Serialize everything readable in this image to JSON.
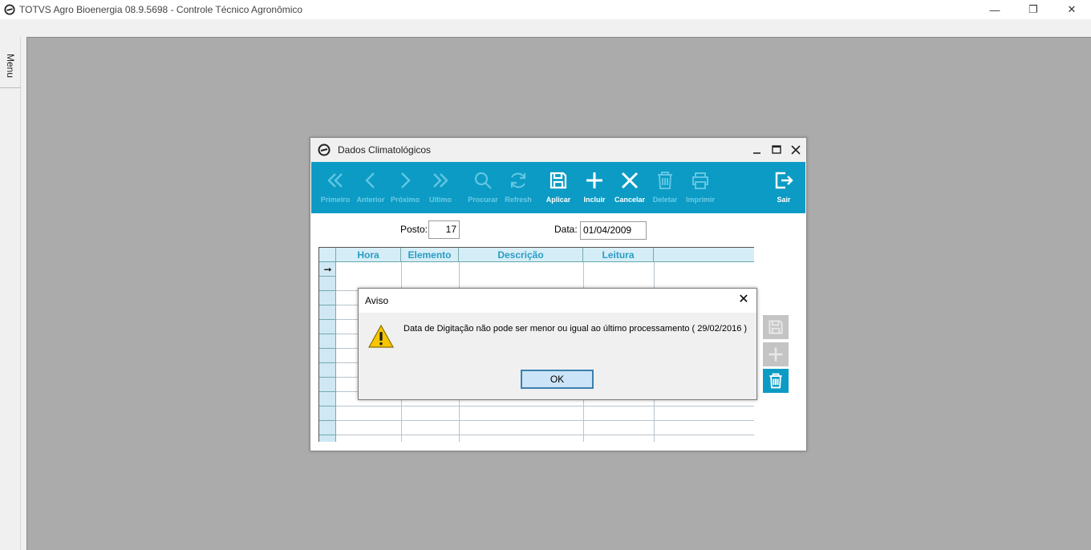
{
  "app": {
    "title": "TOTVS Agro Bioenergia 08.9.5698 - Controle Técnico Agronômico",
    "window_controls": {
      "minimize": "—",
      "restore": "❐",
      "close": "✕"
    }
  },
  "sidebar": {
    "menu_label": "Menu"
  },
  "child_window": {
    "title": "Dados Climatológicos",
    "toolbar": [
      {
        "label": "Primeiro",
        "icon": "first-icon",
        "enabled": false
      },
      {
        "label": "Anterior",
        "icon": "previous-icon",
        "enabled": false
      },
      {
        "label": "Próximo",
        "icon": "next-icon",
        "enabled": false
      },
      {
        "label": "Ultimo",
        "icon": "last-icon",
        "enabled": false
      },
      {
        "label": "Procurar",
        "icon": "search-icon",
        "enabled": false
      },
      {
        "label": "Refresh",
        "icon": "refresh-icon",
        "enabled": false
      },
      {
        "label": "Aplicar",
        "icon": "save-icon",
        "enabled": true
      },
      {
        "label": "Incluir",
        "icon": "plus-icon",
        "enabled": true
      },
      {
        "label": "Cancelar",
        "icon": "close-icon",
        "enabled": true
      },
      {
        "label": "Deletar",
        "icon": "trash-icon",
        "enabled": false
      },
      {
        "label": "Imprimir",
        "icon": "printer-icon",
        "enabled": false
      },
      {
        "label": "Sair",
        "icon": "exit-icon",
        "enabled": true
      }
    ],
    "form": {
      "posto_label": "Posto:",
      "posto_value": "17",
      "data_label": "Data:",
      "data_value": "01/04/2009"
    },
    "grid": {
      "columns": [
        "Hora",
        "Elemento",
        "Descrição",
        "Leitura",
        ""
      ],
      "current_row_marker": "➞"
    }
  },
  "dialog": {
    "title": "Aviso",
    "close": "✕",
    "message": "Data de Digitação não pode ser menor ou igual ao último processamento ( 29/02/2016 )",
    "ok_label": "OK"
  },
  "colors": {
    "toolbar": "#0b9bc4",
    "toolbar_label_enabled": "#ffffff",
    "toolbar_label_disabled": "#6ccbe6",
    "grid_header_text": "#2a9dc4",
    "mdi_background": "#ababab",
    "ok_button_border": "#3c7fb1"
  }
}
